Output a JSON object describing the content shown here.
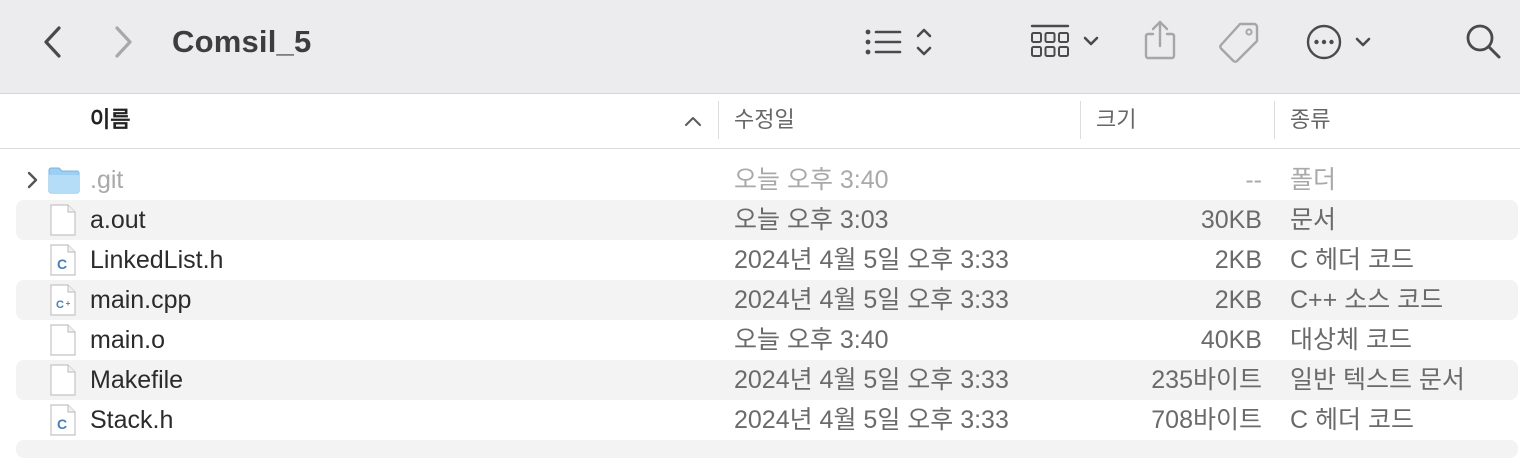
{
  "window": {
    "title": "Comsil_5"
  },
  "toolbar": {
    "back_icon": "chevron-left-icon",
    "forward_icon": "chevron-right-icon",
    "view_list_icon": "list-view-icon",
    "group_icon": "grid-group-icon",
    "share_icon": "share-icon",
    "tag_icon": "tag-icon",
    "more_icon": "ellipsis-circle-icon",
    "search_icon": "search-icon"
  },
  "columns": {
    "name": "이름",
    "date": "수정일",
    "size": "크기",
    "kind": "종류",
    "sort": "ascending"
  },
  "files": [
    {
      "name": ".git",
      "date": "오늘 오후 3:40",
      "size": "--",
      "kind": "폴더",
      "icon": "folder-icon",
      "expandable": true,
      "dimmed": true
    },
    {
      "name": "a.out",
      "date": "오늘 오후 3:03",
      "size": "30KB",
      "kind": "문서",
      "icon": "document-icon",
      "expandable": false,
      "dimmed": false
    },
    {
      "name": "LinkedList.h",
      "date": "2024년 4월 5일 오후 3:33",
      "size": "2KB",
      "kind": "C 헤더 코드",
      "icon": "c-header-file-icon",
      "expandable": false,
      "dimmed": false
    },
    {
      "name": "main.cpp",
      "date": "2024년 4월 5일 오후 3:33",
      "size": "2KB",
      "kind": "C++ 소스 코드",
      "icon": "cpp-source-file-icon",
      "expandable": false,
      "dimmed": false
    },
    {
      "name": "main.o",
      "date": "오늘 오후 3:40",
      "size": "40KB",
      "kind": "대상체 코드",
      "icon": "document-icon",
      "expandable": false,
      "dimmed": false
    },
    {
      "name": "Makefile",
      "date": "2024년 4월 5일 오후 3:33",
      "size": "235바이트",
      "kind": "일반 텍스트 문서",
      "icon": "document-icon",
      "expandable": false,
      "dimmed": false
    },
    {
      "name": "Stack.h",
      "date": "2024년 4월 5일 오후 3:33",
      "size": "708바이트",
      "kind": "C 헤더 코드",
      "icon": "c-header-file-icon",
      "expandable": false,
      "dimmed": false
    }
  ],
  "colors": {
    "toolbar_bg": "#ececee",
    "row_alt_bg": "#f3f3f4",
    "folder_blue": "#8cc8f0",
    "c_badge": "#4a7fb0"
  }
}
